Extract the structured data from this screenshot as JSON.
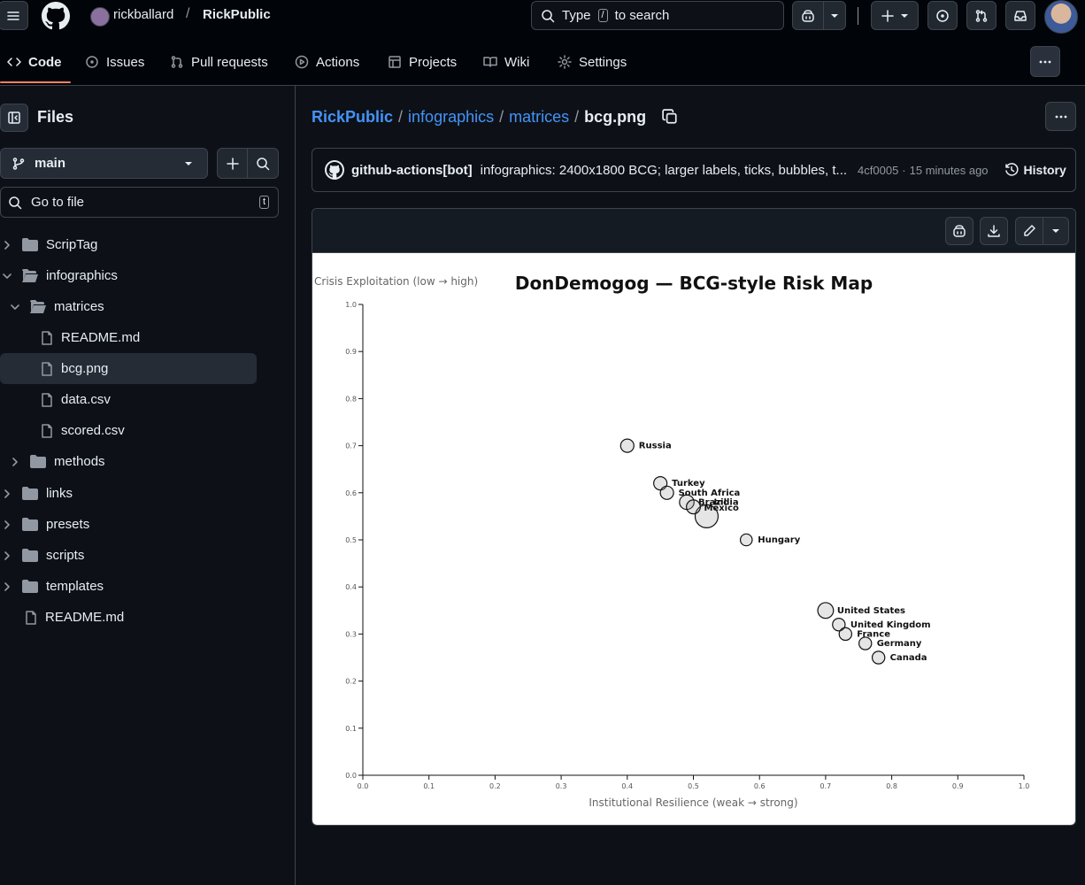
{
  "header": {
    "owner": "rickballard",
    "separator": "/",
    "repo": "RickPublic",
    "search": {
      "prefix": "Type",
      "key": "/",
      "suffix": "to search"
    }
  },
  "tabs": [
    {
      "label": "Code",
      "icon": "code-icon"
    },
    {
      "label": "Issues",
      "icon": "issue-icon"
    },
    {
      "label": "Pull requests",
      "icon": "pull-request-icon"
    },
    {
      "label": "Actions",
      "icon": "play-icon"
    },
    {
      "label": "Projects",
      "icon": "table-icon"
    },
    {
      "label": "Wiki",
      "icon": "book-icon"
    },
    {
      "label": "Settings",
      "icon": "gear-icon"
    }
  ],
  "sidebar": {
    "title": "Files",
    "branch": "main",
    "goto_placeholder": "Go to file",
    "goto_key": "t",
    "tree": [
      {
        "label": "ScripTag",
        "kind": "folder",
        "state": "collapsed"
      },
      {
        "label": "infographics",
        "kind": "folder",
        "state": "expanded"
      },
      {
        "label": "matrices",
        "kind": "folder",
        "state": "expanded"
      },
      {
        "label": "README.md",
        "kind": "file"
      },
      {
        "label": "bcg.png",
        "kind": "file",
        "selected": true
      },
      {
        "label": "data.csv",
        "kind": "file"
      },
      {
        "label": "scored.csv",
        "kind": "file"
      },
      {
        "label": "methods",
        "kind": "folder",
        "state": "collapsed"
      },
      {
        "label": "links",
        "kind": "folder",
        "state": "collapsed"
      },
      {
        "label": "presets",
        "kind": "folder",
        "state": "collapsed"
      },
      {
        "label": "scripts",
        "kind": "folder",
        "state": "collapsed"
      },
      {
        "label": "templates",
        "kind": "folder",
        "state": "collapsed"
      },
      {
        "label": "README.md",
        "kind": "file"
      }
    ]
  },
  "breadcrumb": [
    "RickPublic",
    "infographics",
    "matrices",
    "bcg.png"
  ],
  "commit": {
    "author": "github-actions[bot]",
    "message": "infographics: 2400x1800 BCG; larger labels, ticks, bubbles, t...",
    "sha": "4cf0005",
    "time": "15 minutes ago",
    "history_label": "History"
  },
  "chart_data": {
    "type": "scatter",
    "title": "DonDemogog — BCG-style Risk Map",
    "xlabel": "Institutional Resilience (weak → strong)",
    "ylabel": "Crisis Exploitation (low → high)",
    "xlim": [
      0,
      1
    ],
    "ylim": [
      0,
      1
    ],
    "xticks": [
      "0.0",
      "0.1",
      "0.2",
      "0.3",
      "0.4",
      "0.5",
      "0.6",
      "0.7",
      "0.8",
      "0.9",
      "1.0"
    ],
    "yticks": [
      "0.0",
      "0.1",
      "0.2",
      "0.3",
      "0.4",
      "0.5",
      "0.6",
      "0.7",
      "0.8",
      "0.9",
      "1.0"
    ],
    "grid": false,
    "points": [
      {
        "label": "Russia",
        "x": 0.4,
        "y": 0.7,
        "size": 1
      },
      {
        "label": "Turkey",
        "x": 0.45,
        "y": 0.62,
        "size": 1
      },
      {
        "label": "South Africa",
        "x": 0.46,
        "y": 0.6,
        "size": 1
      },
      {
        "label": "Brazil",
        "x": 0.49,
        "y": 0.58,
        "size": 1.2
      },
      {
        "label": "India",
        "x": 0.52,
        "y": 0.55,
        "size": 3
      },
      {
        "label": "Mexico",
        "x": 0.5,
        "y": 0.57,
        "size": 1.1
      },
      {
        "label": "Hungary",
        "x": 0.58,
        "y": 0.5,
        "size": 0.8
      },
      {
        "label": "United States",
        "x": 0.7,
        "y": 0.35,
        "size": 1.4
      },
      {
        "label": "United Kingdom",
        "x": 0.72,
        "y": 0.32,
        "size": 0.9
      },
      {
        "label": "France",
        "x": 0.73,
        "y": 0.3,
        "size": 0.9
      },
      {
        "label": "Germany",
        "x": 0.76,
        "y": 0.28,
        "size": 0.9
      },
      {
        "label": "Canada",
        "x": 0.78,
        "y": 0.25,
        "size": 0.9
      }
    ]
  }
}
